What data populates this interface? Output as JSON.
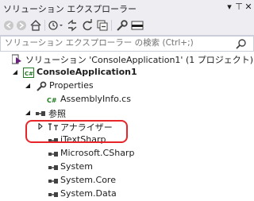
{
  "window": {
    "title": "ソリューション エクスプローラー",
    "controls": {
      "pin": "⊤",
      "close": "✕"
    }
  },
  "toolbar": {
    "buttons": [
      {
        "icon": "back-icon"
      },
      {
        "icon": "forward-icon"
      },
      {
        "icon": "home-icon"
      },
      {
        "icon": "history-icon"
      },
      {
        "icon": "sync-icon"
      },
      {
        "icon": "refresh-icon"
      },
      {
        "icon": "collapse-all-icon"
      },
      {
        "icon": "properties-icon"
      },
      {
        "icon": "preview-icon"
      }
    ]
  },
  "search": {
    "placeholder": "ソリューション エクスプローラー の検索 (Ctrl+;)"
  },
  "tree": {
    "solution": "ソリューション 'ConsoleApplication1' (1 プロジェクト)",
    "project": "ConsoleApplication1",
    "properties": "Properties",
    "assembly_info": "AssemblyInfo.cs",
    "references": "参照",
    "analyzers": "アナライザー",
    "refs": [
      "iTextSharp",
      "Microsoft.CSharp",
      "System",
      "System.Core",
      "System.Data"
    ]
  },
  "colors": {
    "highlight_border": "#e8262a",
    "project_badge": "#1d7a1d",
    "chrome_bg": "#eeeef2"
  }
}
